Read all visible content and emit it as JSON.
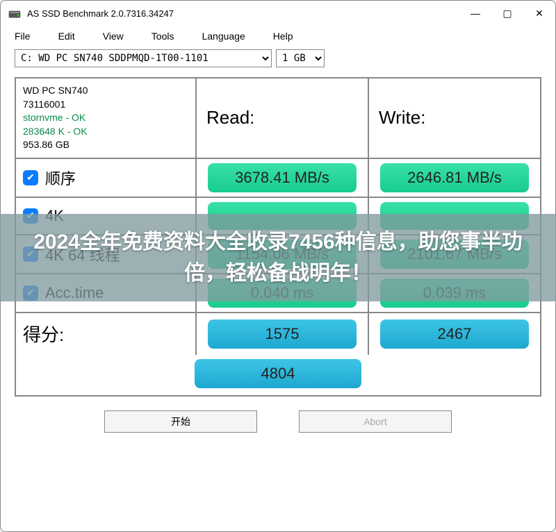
{
  "window": {
    "title": "AS SSD Benchmark 2.0.7316.34247"
  },
  "menu": {
    "file": "File",
    "edit": "Edit",
    "view": "View",
    "tools": "Tools",
    "language": "Language",
    "help": "Help"
  },
  "drive": {
    "selected": "C: WD PC SN740 SDDPMQD-1T00-1101",
    "size": "1 GB"
  },
  "info": {
    "model": "WD PC SN740",
    "serial": "73116001",
    "driver": "stornvme - OK",
    "align": "283648 K - OK",
    "capacity": "953.86 GB"
  },
  "headers": {
    "read": "Read:",
    "write": "Write:"
  },
  "tests": {
    "seq": {
      "label": "顺序",
      "read": "3678.41 MB/s",
      "write": "2646.81 MB/s"
    },
    "fourk": {
      "label": "4K",
      "read": "",
      "write": ""
    },
    "fourk64": {
      "label": "4K 64 线程",
      "read": "1154.06 MB/s",
      "write": "2101.67 MB/s"
    },
    "acc": {
      "label": "Acc.time",
      "read": "0.040 ms",
      "write": "0.039 ms"
    }
  },
  "score": {
    "label": "得分:",
    "read": "1575",
    "write": "2467",
    "total": "4804"
  },
  "buttons": {
    "start": "开始",
    "abort": "Abort"
  },
  "overlay": {
    "text": "2024全年免费资料大全收录7456种信息，助您事半功倍，轻松备战明年！"
  }
}
